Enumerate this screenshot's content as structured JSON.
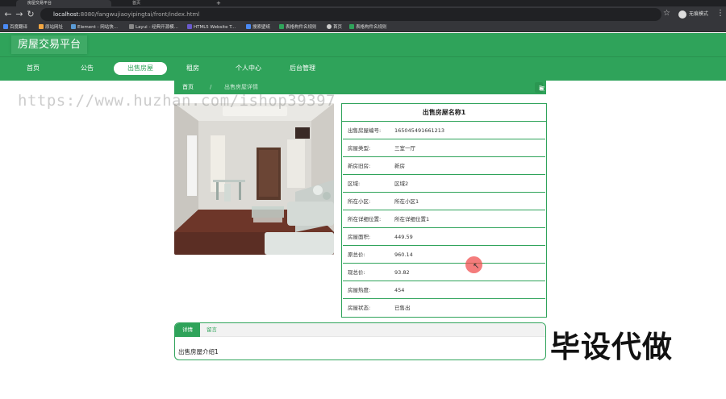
{
  "browser": {
    "tabs": [
      {
        "title": "房屋交易平台",
        "active": true
      },
      {
        "title": "首页",
        "active": false
      }
    ],
    "new_tab": "+",
    "url_host": "localhost",
    "url_rest": ":8080/fangwujiaoyipingtai/front/index.html",
    "profile": "无痕模式",
    "bookmarks": [
      "百度翻译",
      "原站网址",
      "Element - 网站快...",
      "Layui - 经典开源模...",
      "HTML5 Website T...",
      "搜索壁纸",
      "表格构件名规则",
      "首页",
      "表格构件名规则"
    ]
  },
  "header": {
    "site_title": "房屋交易平台",
    "nav": [
      "首页",
      "公告",
      "出售房屋",
      "租房",
      "个人中心",
      "后台管理"
    ],
    "active_nav_index": 2
  },
  "breadcrumb": {
    "home": "首页",
    "separator": "/",
    "current": "出售房屋详情",
    "favorite_label": "取消收藏"
  },
  "detail": {
    "title": "出售房屋名称1",
    "rows": [
      {
        "label": "出售房屋编号:",
        "value": "165045491661213"
      },
      {
        "label": "房屋类型:",
        "value": "三室一厅"
      },
      {
        "label": "新房旧房:",
        "value": "新房"
      },
      {
        "label": "区域:",
        "value": "区域2"
      },
      {
        "label": "所在小区:",
        "value": "所在小区1"
      },
      {
        "label": "所在详细位置:",
        "value": "所在详细位置1"
      },
      {
        "label": "房屋面积:",
        "value": "449.59"
      },
      {
        "label": "原总价:",
        "value": "960.14"
      },
      {
        "label": "现总价:",
        "value": "93.82"
      },
      {
        "label": "房屋热度:",
        "value": "454"
      },
      {
        "label": "房屋状态:",
        "value": "已售出"
      }
    ]
  },
  "tabs": {
    "items": [
      "详情",
      "留言"
    ],
    "active_index": 0,
    "content": "出售房屋介绍1"
  },
  "overlay": {
    "watermark": "https://www.huzhan.com/ishop39397",
    "promo": "毕设代做"
  },
  "colors": {
    "primary": "#2fa35a",
    "browser_bg": "#35363a"
  }
}
